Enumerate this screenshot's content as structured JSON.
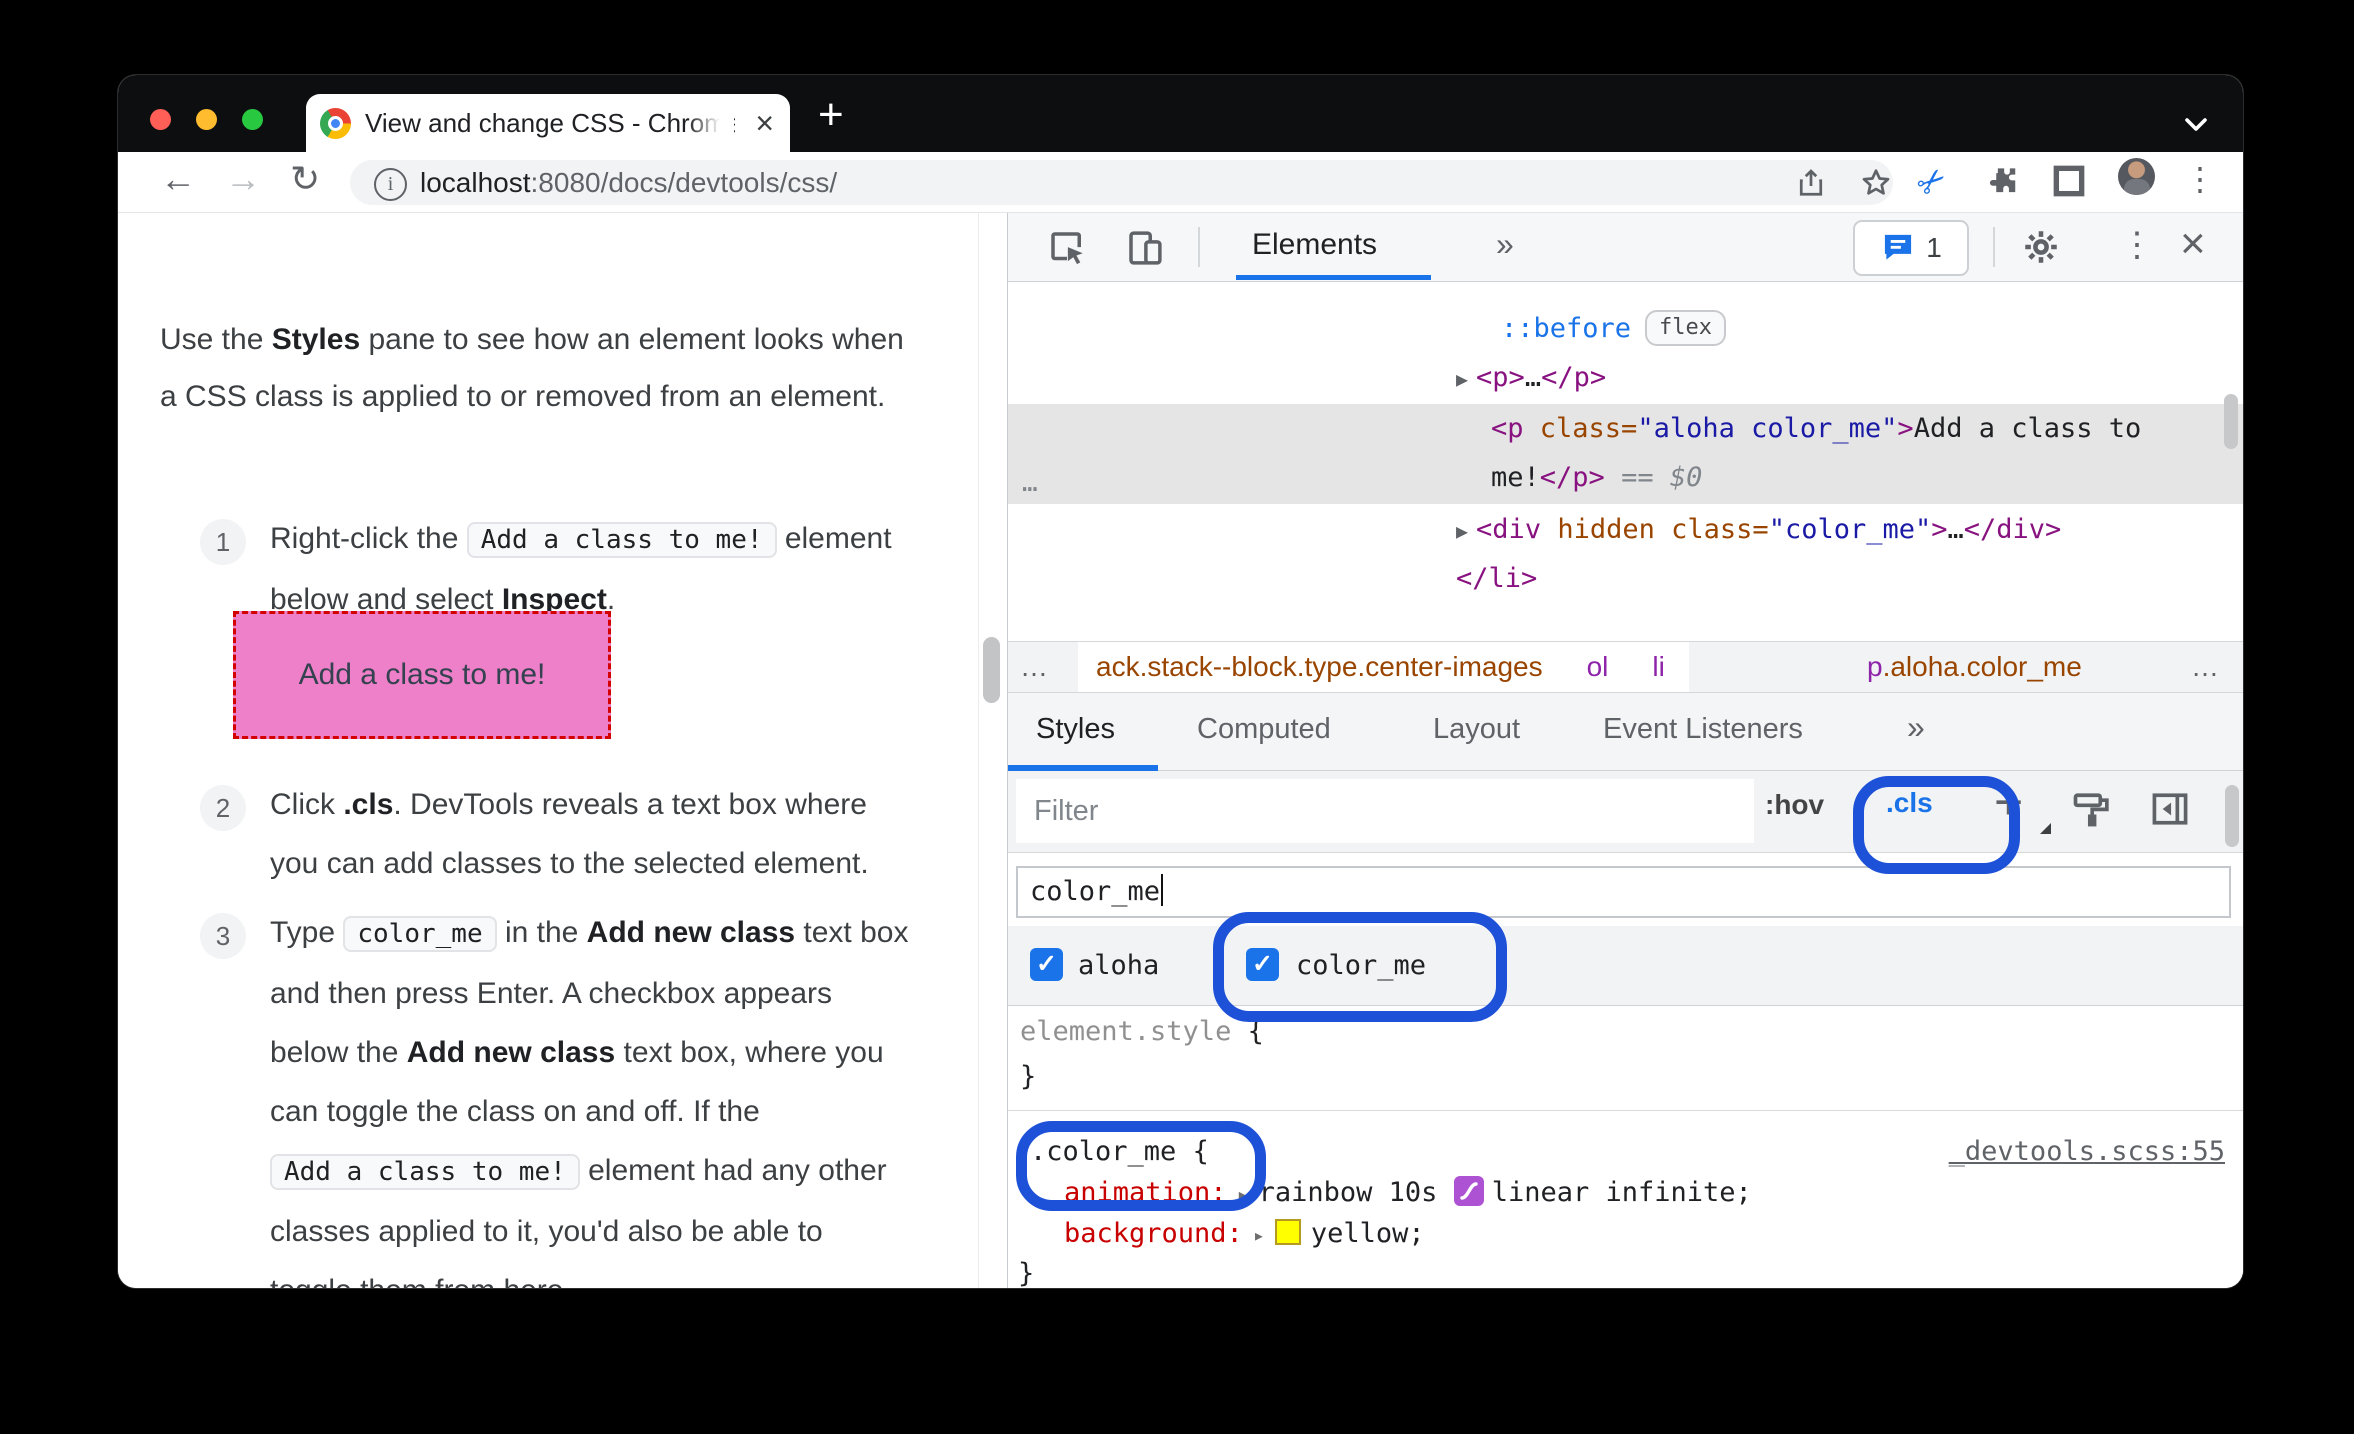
{
  "browser": {
    "tab": {
      "title": "View and change CSS - Chrome",
      "close": "×",
      "new_tab": "+"
    },
    "toolbar": {
      "back": "←",
      "forward": "→",
      "reload": "↻",
      "url_host": "localhost",
      "url_rest": ":8080/docs/devtools/css/"
    }
  },
  "doc": {
    "intro": {
      "t1": "Use the ",
      "b1": "Styles",
      "t2": " pane to see how an element looks when a CSS class is applied to or removed from an element."
    },
    "steps": [
      {
        "num": "1",
        "t1": "Right-click the ",
        "code1": "Add a class to me!",
        "t2": " element below and select ",
        "b1": "Inspect",
        "t3": "."
      },
      {
        "num": "2",
        "t1": "Click ",
        "b1": ".cls",
        "t2": ". DevTools reveals a text box where you can add classes to the selected element."
      },
      {
        "num": "3",
        "t1": "Type ",
        "code1": "color_me",
        "t2": " in the ",
        "b1": "Add new class",
        "t3": " text box and then press Enter. A checkbox appears below the ",
        "b2": "Add new class",
        "t4": " text box, where you can toggle the class on and off. If the ",
        "code2": "Add a class to me!",
        "t5": " element had any other classes applied to it, you'd also be able to toggle them from here."
      }
    ],
    "demo_box": {
      "label": "Add a class to me!",
      "bg": "#ee7fc9",
      "border": "#d40000"
    }
  },
  "devtools": {
    "toolbar": {
      "panel_tab": "Elements",
      "more_tabs": "»",
      "issues_count": "1"
    },
    "dom": {
      "gutter_dots": "…",
      "row_before": {
        "pseudo": "::before",
        "badge": "flex"
      },
      "row_p_collapsed": {
        "arrow": "▶",
        "open": "<p>",
        "dots": "…",
        "close": "</p>"
      },
      "row_selected": {
        "line1": {
          "tag_open": "<p ",
          "attr": "class=",
          "value": "\"aloha color_me\"",
          "bracket": ">",
          "text": "Add a class to"
        },
        "line2": {
          "text": "me!",
          "tag_close": "</p>",
          "eq": " == ",
          "dollar": "$0"
        }
      },
      "row_div": {
        "arrow": "▶",
        "tag_open": "<div ",
        "attr1": "hidden",
        "sp": " ",
        "attr2": "class=",
        "value": "\"color_me\"",
        "bracket": ">",
        "dots": "…",
        "tag_close": "</div>"
      },
      "row_li_close": "</li>"
    },
    "breadcrumbs": {
      "left_overflow": "…",
      "crumb1": "ack.stack--block.type.center-images",
      "crumb2": "ol",
      "crumb3": "li",
      "crumb4_tag": "p",
      "crumb4_classes": ".aloha.color_me",
      "right_overflow": "…"
    },
    "styles_tabs": [
      "Styles",
      "Computed",
      "Layout",
      "Event Listeners",
      "»"
    ],
    "filter": {
      "placeholder": "Filter",
      "hov": ":hov",
      "cls": ".cls",
      "add": "+"
    },
    "class_editor": {
      "input_value": "color_me",
      "checkboxes": [
        {
          "label": "aloha",
          "check": "✓"
        },
        {
          "label": "color_me",
          "check": "✓"
        }
      ]
    },
    "element_style": {
      "selector": "element.style",
      "open": " {",
      "close": "}"
    },
    "rule": {
      "selector": ".color_me",
      "open": " {",
      "source": "_devtools.scss:55",
      "prop1": {
        "name": "animation:",
        "arrow": "▸",
        "v1": "rainbow 10s ",
        "v2": "linear infinite;"
      },
      "prop2": {
        "name": "background:",
        "arrow": "▸",
        "v1": "yellow;",
        "swatch": "#ffff00"
      },
      "close": "}"
    }
  },
  "colors": {
    "accent_blue": "#1a73e8",
    "annotation_blue": "#1d51d8",
    "selected_row": "#e5e5e5",
    "easing_icon": "#ae52d4",
    "demo_pink": "#ee7fc9"
  }
}
